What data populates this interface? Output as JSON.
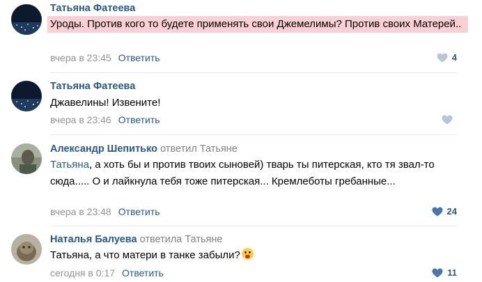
{
  "comments": [
    {
      "author": "Татьяна Фатеева",
      "replied_to": "",
      "text": "Уроды. Против кого то будете применять свои Джемелимы? Против своих Матерей..",
      "time": "вчера в 23:45",
      "reply_label": "Ответить",
      "likes": "4",
      "highlighted": true
    },
    {
      "author": "Татьяна Фатеева",
      "replied_to": "",
      "text": "Джавелины! Извените!",
      "time": "вчера в 23:46",
      "reply_label": "Ответить",
      "likes": "",
      "highlighted": false
    },
    {
      "author": "Александр Шепитько",
      "replied_to": "ответил Татьяне",
      "mention": "Татьяна",
      "text": ", а хоть бы и против твоих сыновей) тварь ты питерская, кто тя звал-то сюда..... О и лайкнула тебя тоже питерская... Кремлеботы гребанные...",
      "time": "вчера в 23:48",
      "reply_label": "Ответить",
      "likes": "24",
      "highlighted": false
    },
    {
      "author": "Наталья Балуева",
      "replied_to": "ответила Татьяне",
      "text": "Татьяна, а что матери в танке забыли?",
      "emoji": "screaming-face-emoji",
      "time": "сегодня в 0:17",
      "reply_label": "Ответить",
      "likes": "11",
      "highlighted": false
    }
  ],
  "colors": {
    "link": "#2a5885",
    "meta": "#939393",
    "highlight": "#f9d0d6",
    "like_filled": "#4a76a8",
    "like_empty": "#b7c6d6"
  }
}
